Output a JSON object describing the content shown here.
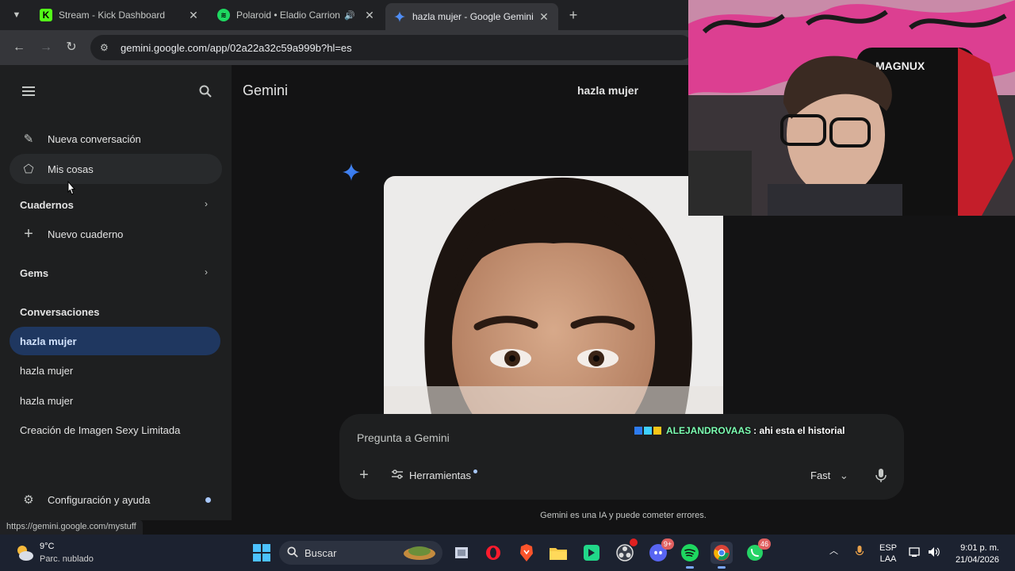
{
  "browser": {
    "tabs": [
      {
        "title": "Stream - Kick Dashboard",
        "favicon": "kick-icon",
        "color": "#53fc18"
      },
      {
        "title": "Polaroid • Eladio Carrion",
        "favicon": "spotify-icon",
        "color": "#1ed760"
      },
      {
        "title": "hazla mujer - Google Gemini",
        "favicon": "gemini-icon",
        "active": true
      }
    ],
    "url": "gemini.google.com/app/02a22a32c59a999b?hl=es"
  },
  "sidebar": {
    "new_chat": "Nueva conversación",
    "my_stuff": "Mis cosas",
    "notebooks_heading": "Cuadernos",
    "new_notebook": "Nuevo cuaderno",
    "gems_heading": "Gems",
    "conversations_heading": "Conversaciones",
    "conversations": [
      {
        "label": "hazla mujer",
        "active": true
      },
      {
        "label": "hazla mujer"
      },
      {
        "label": "hazla mujer"
      },
      {
        "label": "Creación de Imagen Sexy Limitada"
      }
    ],
    "settings": "Configuración y ayuda"
  },
  "main": {
    "app_title": "Gemini",
    "conversation_title": "hazla mujer",
    "prompt_placeholder": "Pregunta a Gemini",
    "tools_label": "Herramientas",
    "model_label": "Fast",
    "disclaimer": "Gemini es una IA y puede cometer errores."
  },
  "stream_overlay": {
    "chat_user": "ALEJANDROVAAS",
    "chat_message": ": ahi esta el historial",
    "webcam_text": "MAGNUX"
  },
  "status_url": "https://gemini.google.com/mystuff",
  "taskbar": {
    "temperature": "9°C",
    "weather": "Parc. nublado",
    "search_label": "Buscar",
    "discord_badge": "9+",
    "whatsapp_badge": "46",
    "language": "ESP",
    "language_sub": "LAA",
    "time": "9:01 p. m.",
    "date": "21/04/2026"
  },
  "colors": {
    "accent": "#a8c7fa",
    "active_conversation": "#1f3760",
    "background": "#131314",
    "sidebar": "#1e1f20"
  }
}
